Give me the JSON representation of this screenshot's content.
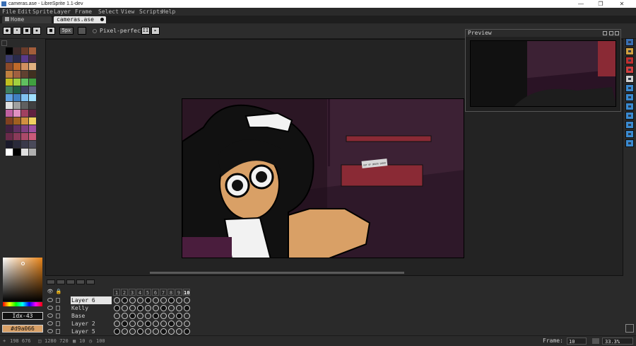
{
  "window": {
    "title": "cameras.ase - LibreSprite 1.1-dev"
  },
  "menu": [
    "File",
    "Edit",
    "Sprite",
    "Layer",
    "Frame",
    "Select",
    "View",
    "Scripts",
    "Help"
  ],
  "tabs": [
    {
      "label": "Home"
    },
    {
      "label": "cameras.ase"
    }
  ],
  "toolbar": {
    "brush_size": "5px",
    "pixel_perfect_label": "Pixel-perfect"
  },
  "palette": {
    "colors": [
      "#000000",
      "#3d2b2b",
      "#6b3c2a",
      "#a35d3a",
      "#3a3a6b",
      "#2a2a4a",
      "#5a3a8a",
      "#4a2a4a",
      "#8b4a2a",
      "#c06a2a",
      "#d09060",
      "#e0b080",
      "#c08040",
      "#a06040",
      "#604030",
      "#403020",
      "#c0c020",
      "#a0d040",
      "#60c060",
      "#40a040",
      "#408060",
      "#206040",
      "#404060",
      "#606080",
      "#60a0e0",
      "#4080c0",
      "#80c0f0",
      "#a0e0ff",
      "#e0e0e0",
      "#a0a0a0",
      "#606060",
      "#404040",
      "#c060a0",
      "#e090c0",
      "#a04060",
      "#602040",
      "#804020",
      "#a06020",
      "#d09040",
      "#f0d060",
      "#402040",
      "#603060",
      "#804080",
      "#a050a0",
      "#6a2a4a",
      "#8a3a5a",
      "#aa4a6a",
      "#ca5a7a",
      "#1a1a2a",
      "#2a2a3a",
      "#3a3a4a",
      "#4a4a5a",
      "#ffffff",
      "#000000",
      "#e0e0e0",
      "#b0b0b0"
    ]
  },
  "color_picker": {
    "index_label": "Idx-43",
    "hex_label": "#d9a066",
    "fg_color": "#d9a066"
  },
  "preview": {
    "title": "Preview"
  },
  "layers": [
    {
      "name": "Layer 6",
      "active": true
    },
    {
      "name": "Kelly",
      "active": false
    },
    {
      "name": "Base",
      "active": false
    },
    {
      "name": "Layer 2",
      "active": false
    },
    {
      "name": "Layer 5",
      "active": false
    }
  ],
  "frames": [
    "1",
    "2",
    "3",
    "4",
    "5",
    "6",
    "7",
    "8",
    "9",
    "10"
  ],
  "frame_selected": "10",
  "statusbar": {
    "cursor_pos": "198 676",
    "sprite_size": "1280 720",
    "frame_count": "10",
    "duration": "100",
    "frame_label": "Frame:",
    "frame_value": "10",
    "zoom": "33.3%"
  },
  "sprite": {
    "sign_text": "OUT OF ORDER SORRY"
  }
}
